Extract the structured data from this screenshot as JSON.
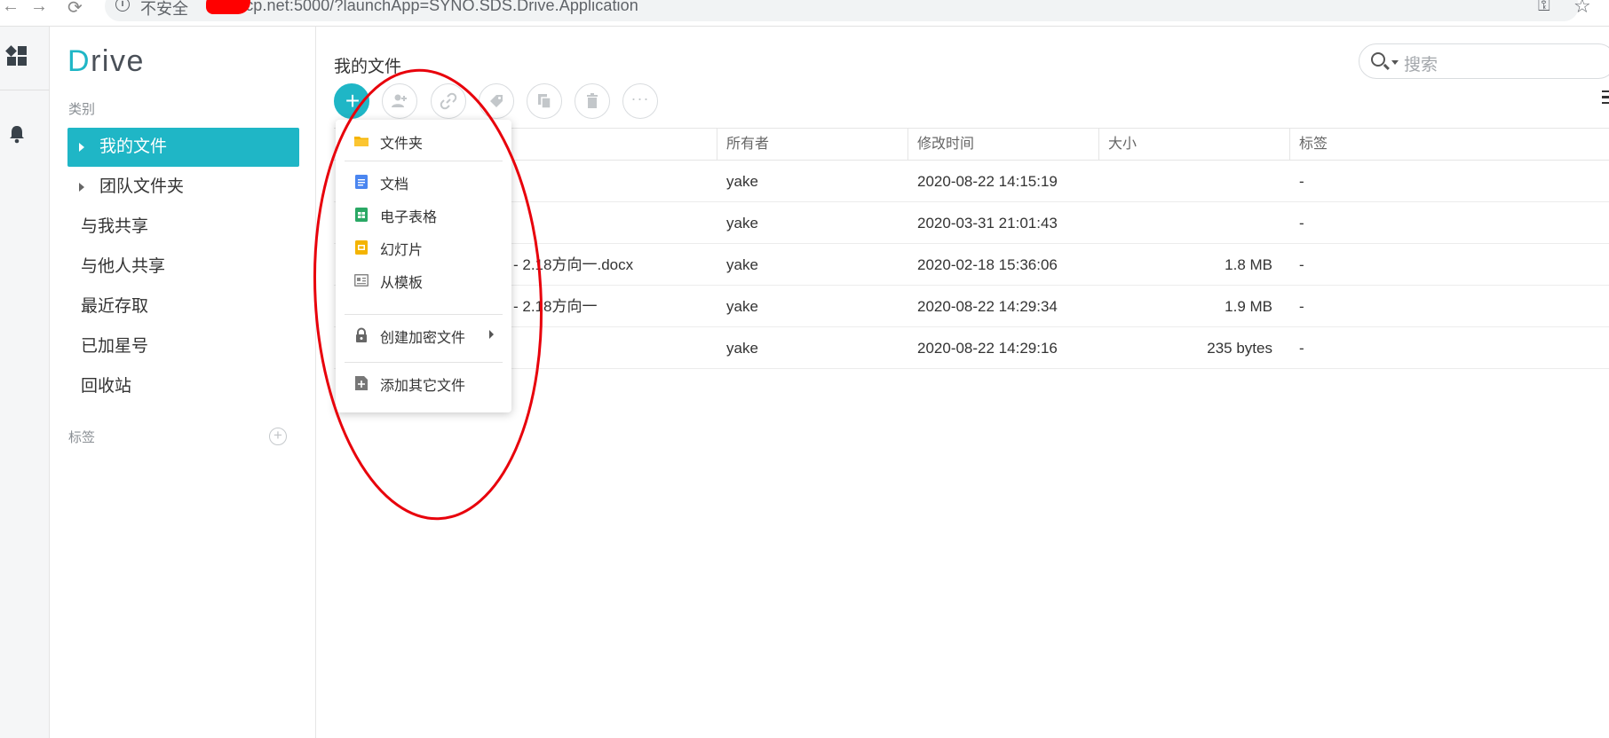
{
  "browser": {
    "insecure_label": "不安全",
    "url_visible": "picp.net:5000/?launchApp=SYNO.SDS.Drive.Application"
  },
  "app": {
    "logo_initial": "D",
    "logo_rest": "rive",
    "brand_color": "#1fb6c6"
  },
  "sidebar": {
    "category_label": "类别",
    "items": [
      {
        "label": "我的文件",
        "active": true
      },
      {
        "label": "团队文件夹"
      },
      {
        "label": "与我共享"
      },
      {
        "label": "与他人共享"
      },
      {
        "label": "最近存取"
      },
      {
        "label": "已加星号"
      },
      {
        "label": "回收站"
      }
    ],
    "tags_label": "标签"
  },
  "main": {
    "title": "我的文件",
    "search_placeholder": "搜索",
    "toolbar_more": "···"
  },
  "table": {
    "headers": [
      "所有者",
      "修改时间",
      "大小",
      "标签"
    ],
    "rows": [
      {
        "name": "",
        "owner": "yake",
        "modified": "2020-08-22 14:15:19",
        "size": "",
        "tags": "-"
      },
      {
        "name": "",
        "owner": "yake",
        "modified": "2020-03-31 21:01:43",
        "size": "",
        "tags": "-"
      },
      {
        "name": "- 2.18方向一.docx",
        "owner": "yake",
        "modified": "2020-02-18 15:36:06",
        "size": "1.8 MB",
        "tags": "-"
      },
      {
        "name": "- 2.18方向一",
        "owner": "yake",
        "modified": "2020-08-22 14:29:34",
        "size": "1.9 MB",
        "tags": "-"
      },
      {
        "name": "",
        "owner": "yake",
        "modified": "2020-08-22 14:29:16",
        "size": "235 bytes",
        "tags": "-"
      }
    ]
  },
  "menu": {
    "items": [
      {
        "label": "文件夹",
        "icon": "folder-icon"
      },
      {
        "label": "文档",
        "icon": "document-icon"
      },
      {
        "label": "电子表格",
        "icon": "spreadsheet-icon"
      },
      {
        "label": "幻灯片",
        "icon": "slides-icon"
      },
      {
        "label": "从模板",
        "icon": "template-icon"
      },
      {
        "label": "创建加密文件",
        "icon": "lock-icon"
      },
      {
        "label": "添加其它文件",
        "icon": "add-file-icon"
      }
    ]
  },
  "annotation_color": "#e8000b"
}
